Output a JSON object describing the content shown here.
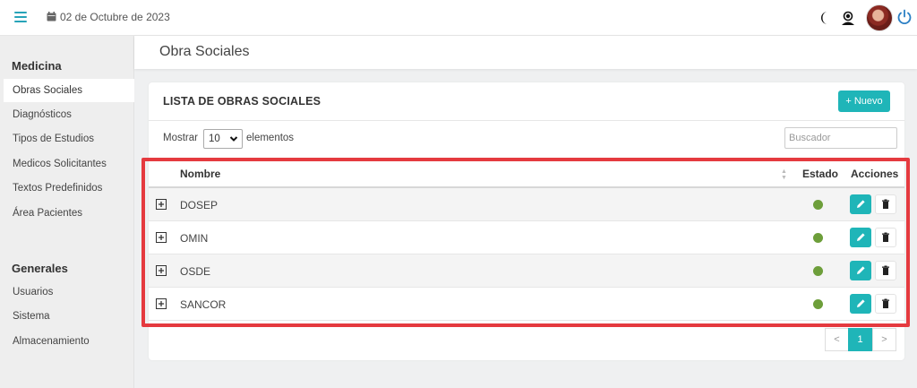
{
  "topbar": {
    "date": "02 de Octubre de 2023",
    "icons": [
      "menu-icon",
      "calendar-icon",
      "moon-icon",
      "support-agent-icon",
      "avatar",
      "power-icon"
    ]
  },
  "sidebar": {
    "sections": [
      {
        "title": "Medicina",
        "items": [
          "Obras Sociales",
          "Diagnósticos",
          "Tipos de Estudios",
          "Medicos Solicitantes",
          "Textos Predefinidos",
          "Área Pacientes"
        ]
      },
      {
        "title": "Generales",
        "items": [
          "Usuarios",
          "Sistema",
          "Almacenamiento"
        ]
      }
    ],
    "active_item": "Obras Sociales"
  },
  "page": {
    "title": "Obra Sociales"
  },
  "card": {
    "title": "LISTA DE OBRAS SOCIALES",
    "new_button": "+ Nuevo",
    "show_label": "Mostrar",
    "page_size": "10",
    "elements_label": "elementos",
    "search_placeholder": "Buscador"
  },
  "table": {
    "columns": [
      "Nombre",
      "Estado",
      "Acciones"
    ],
    "rows": [
      {
        "name": "DOSEP",
        "status": "active"
      },
      {
        "name": "OMIN",
        "status": "active"
      },
      {
        "name": "OSDE",
        "status": "active"
      },
      {
        "name": "SANCOR",
        "status": "active"
      }
    ]
  },
  "pagination": {
    "prev": "<",
    "current": "1",
    "next": ">"
  },
  "colors": {
    "accent": "#1fb5b8",
    "status_active": "#6d9e3a",
    "highlight": "#e53a3f"
  }
}
